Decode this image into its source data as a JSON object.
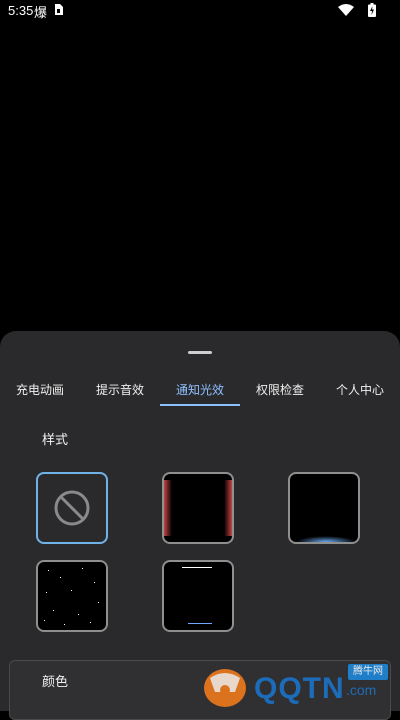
{
  "status_bar": {
    "time": "5:35",
    "app_glyph": "爆",
    "icons": [
      "sim-card-icon",
      "wifi-icon",
      "battery-charging-icon"
    ]
  },
  "tabs": [
    {
      "label": "充电动画",
      "active": false
    },
    {
      "label": "提示音效",
      "active": false
    },
    {
      "label": "通知光效",
      "active": true
    },
    {
      "label": "权限检查",
      "active": false
    },
    {
      "label": "个人中心",
      "active": false
    }
  ],
  "section_title": "样式",
  "style_options": [
    {
      "id": "none",
      "icon": "prohibited-icon",
      "selected": true
    },
    {
      "id": "red-edge-glow",
      "selected": false
    },
    {
      "id": "blue-bottom-glow",
      "selected": false
    },
    {
      "id": "starfield",
      "selected": false
    },
    {
      "id": "top-bottom-lines",
      "selected": false
    }
  ],
  "color_section": {
    "label": "颜色"
  },
  "watermark": {
    "text": "QQTN",
    "suffix": ".com",
    "badge": "腾牛网"
  },
  "colors": {
    "background": "#000000",
    "sheet": "#2a2a2c",
    "accent": "#8ec0ff",
    "selected_border": "#6fb3e6",
    "card_border": "#8f8f8f"
  }
}
